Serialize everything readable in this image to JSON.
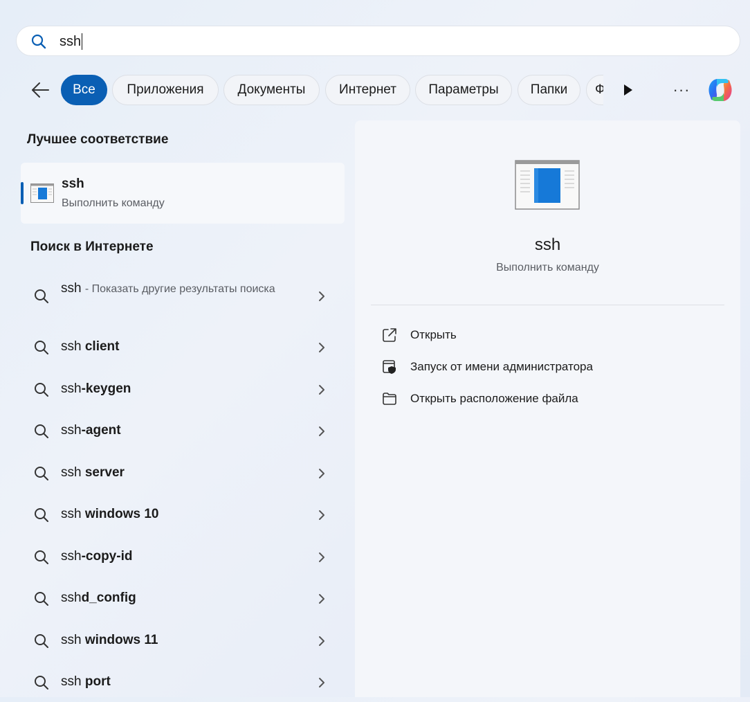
{
  "search": {
    "query": "ssh",
    "icon": "search-icon"
  },
  "filters": {
    "tabs": [
      {
        "label": "Все",
        "active": true
      },
      {
        "label": "Приложения"
      },
      {
        "label": "Документы"
      },
      {
        "label": "Интернет"
      },
      {
        "label": "Параметры"
      },
      {
        "label": "Папки"
      },
      {
        "label": "Ф"
      }
    ],
    "more_label": "···"
  },
  "best_match": {
    "heading": "Лучшее соответствие",
    "name": "ssh",
    "subtitle": "Выполнить команду"
  },
  "web_search": {
    "heading": "Поиск в Интернете",
    "first": {
      "query": "ssh",
      "description": "- Показать другие результаты поиска"
    },
    "suggestions": [
      {
        "prefix": "ssh",
        "bold": " client"
      },
      {
        "prefix": "ssh",
        "bold": "-keygen"
      },
      {
        "prefix": "ssh",
        "bold": "-agent"
      },
      {
        "prefix": "ssh",
        "bold": " server"
      },
      {
        "prefix": "ssh",
        "bold": " windows 10"
      },
      {
        "prefix": "ssh",
        "bold": "-copy-id"
      },
      {
        "prefix": "ssh",
        "bold": "d_config"
      },
      {
        "prefix": "ssh",
        "bold": " windows 11"
      },
      {
        "prefix": "ssh",
        "bold": " port"
      }
    ]
  },
  "detail": {
    "title": "ssh",
    "subtitle": "Выполнить команду",
    "actions": [
      {
        "label": "Открыть",
        "icon": "open-external-icon"
      },
      {
        "label": "Запуск от имени администратора",
        "icon": "shield-admin-icon"
      },
      {
        "label": "Открыть расположение файла",
        "icon": "folder-icon"
      }
    ]
  },
  "colors": {
    "accent": "#0a5fb4",
    "panel": "#f4f6fa"
  }
}
